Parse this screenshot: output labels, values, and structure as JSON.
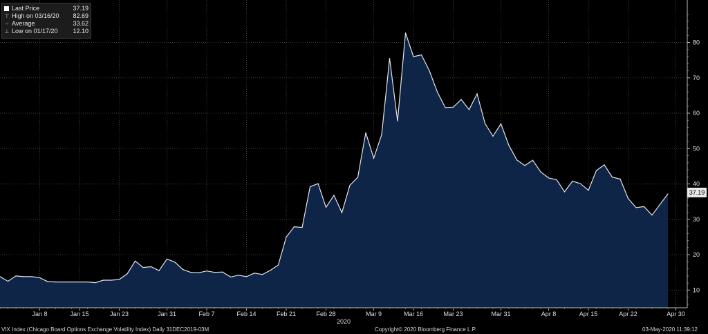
{
  "legend": {
    "last": {
      "label": "Last Price",
      "value": "37.19"
    },
    "high": {
      "label": "High on 03/16/20",
      "value": "82.69"
    },
    "avg": {
      "label": "Average",
      "value": "33.62"
    },
    "low": {
      "label": "Low on 01/17/20",
      "value": "12.10"
    }
  },
  "last_value_box": "37.19",
  "year_label": "2020",
  "footer": {
    "left": "VIX Index (Chicago Board Options Exchange Volatility Index)  Daily 31DEC2019-03M",
    "center": "Copyright© 2020 Bloomberg Finance L.P.",
    "right": "03-May-2020 11:39:12"
  },
  "colors": {
    "background": "#000000",
    "line": "#e6e6e6",
    "area": "#0e2548",
    "grid": "#3a3a3a"
  },
  "chart_data": {
    "type": "area",
    "title": "",
    "ylim": [
      5,
      92
    ],
    "y_ticks": [
      10,
      20,
      30,
      40,
      50,
      60,
      70,
      80
    ],
    "y_axis_position": "right",
    "grid": true,
    "x_tick_labels": [
      "Jan 8",
      "Jan 15",
      "Jan 23",
      "Jan 31",
      "Feb 7",
      "Feb 14",
      "Feb 21",
      "Feb 28",
      "Mar 9",
      "Mar 16",
      "Mar 23",
      "Mar 31",
      "Apr 8",
      "Apr 15",
      "Apr 22",
      "Apr 30"
    ],
    "x_tick_indices": [
      5,
      10,
      15,
      21,
      26,
      31,
      36,
      41,
      47,
      52,
      57,
      63,
      69,
      74,
      79,
      85
    ],
    "series": [
      {
        "values": [
          13.8,
          12.5,
          14.0,
          13.8,
          13.8,
          13.5,
          12.4,
          12.3,
          12.3,
          12.3,
          12.3,
          12.3,
          12.1,
          12.8,
          12.8,
          13.0,
          14.6,
          18.2,
          16.4,
          16.6,
          15.5,
          18.8,
          17.9,
          15.8,
          15.0,
          14.9,
          15.4,
          15.0,
          15.1,
          13.7,
          14.2,
          13.8,
          14.8,
          14.4,
          15.6,
          17.1,
          25.0,
          27.9,
          27.7,
          39.2,
          40.1,
          33.4,
          36.8,
          31.9,
          39.6,
          41.9,
          54.5,
          47.3,
          53.9,
          75.5,
          57.8,
          82.69,
          76.0,
          76.5,
          72.0,
          66.0,
          61.6,
          61.7,
          63.9,
          61.0,
          65.5,
          57.1,
          53.5,
          57.0,
          50.9,
          46.8,
          45.2,
          46.7,
          43.4,
          41.7,
          41.2,
          37.8,
          40.8,
          40.1,
          38.2,
          43.8,
          45.4,
          41.9,
          41.4,
          35.9,
          33.3,
          33.6,
          31.2,
          34.2,
          37.19
        ]
      }
    ]
  }
}
